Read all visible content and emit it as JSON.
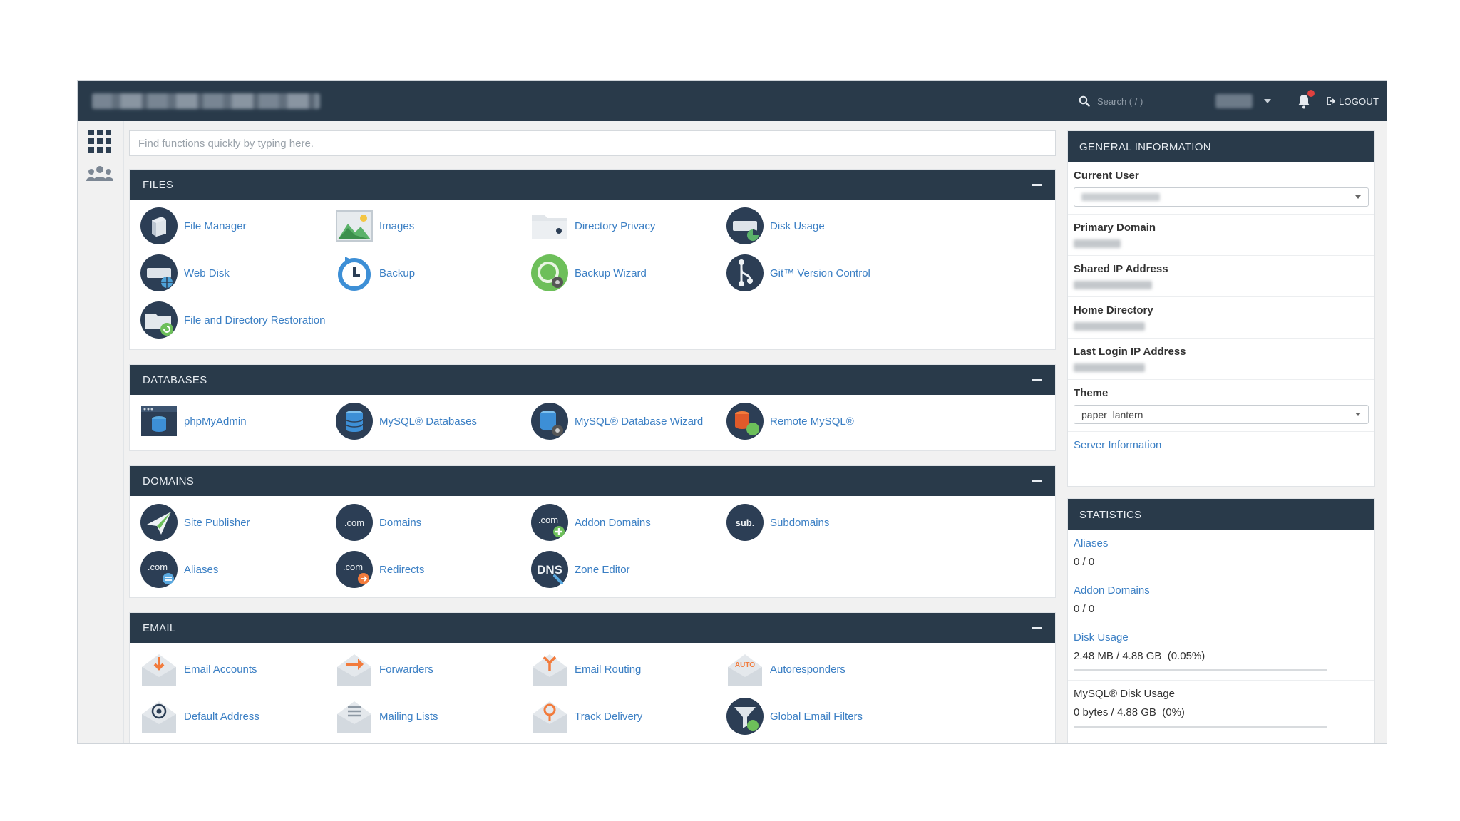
{
  "header": {
    "search_placeholder": "Search ( / )",
    "logout_label": "LOGOUT"
  },
  "quick_search": {
    "placeholder": "Find functions quickly by typing here."
  },
  "sections": [
    {
      "title": "FILES",
      "items": [
        {
          "label": "File Manager",
          "icon": "file-manager-icon"
        },
        {
          "label": "Images",
          "icon": "images-icon"
        },
        {
          "label": "Directory Privacy",
          "icon": "directory-privacy-icon"
        },
        {
          "label": "Disk Usage",
          "icon": "disk-usage-icon"
        },
        {
          "label": "Web Disk",
          "icon": "web-disk-icon"
        },
        {
          "label": "Backup",
          "icon": "backup-icon"
        },
        {
          "label": "Backup Wizard",
          "icon": "backup-wizard-icon"
        },
        {
          "label": "Git™ Version Control",
          "icon": "git-icon"
        },
        {
          "label": "File and Directory Restoration",
          "icon": "restoration-icon"
        }
      ]
    },
    {
      "title": "DATABASES",
      "items": [
        {
          "label": "phpMyAdmin",
          "icon": "phpmyadmin-icon"
        },
        {
          "label": "MySQL® Databases",
          "icon": "mysql-databases-icon"
        },
        {
          "label": "MySQL® Database Wizard",
          "icon": "mysql-wizard-icon"
        },
        {
          "label": "Remote MySQL®",
          "icon": "remote-mysql-icon"
        }
      ]
    },
    {
      "title": "DOMAINS",
      "items": [
        {
          "label": "Site Publisher",
          "icon": "site-publisher-icon"
        },
        {
          "label": "Domains",
          "icon": "domains-icon",
          "badge": ".com"
        },
        {
          "label": "Addon Domains",
          "icon": "addon-domains-icon",
          "badge": ".com"
        },
        {
          "label": "Subdomains",
          "icon": "subdomains-icon",
          "badge": "sub."
        },
        {
          "label": "Aliases",
          "icon": "aliases-icon",
          "badge": ".com"
        },
        {
          "label": "Redirects",
          "icon": "redirects-icon",
          "badge": ".com"
        },
        {
          "label": "Zone Editor",
          "icon": "zone-editor-icon",
          "badge": "DNS"
        }
      ]
    },
    {
      "title": "EMAIL",
      "items": [
        {
          "label": "Email Accounts",
          "icon": "email-accounts-icon"
        },
        {
          "label": "Forwarders",
          "icon": "forwarders-icon"
        },
        {
          "label": "Email Routing",
          "icon": "email-routing-icon"
        },
        {
          "label": "Autoresponders",
          "icon": "autoresponders-icon",
          "badge": "AUTO"
        },
        {
          "label": "Default Address",
          "icon": "default-address-icon"
        },
        {
          "label": "Mailing Lists",
          "icon": "mailing-lists-icon"
        },
        {
          "label": "Track Delivery",
          "icon": "track-delivery-icon"
        },
        {
          "label": "Global Email Filters",
          "icon": "global-filters-icon"
        }
      ]
    }
  ],
  "general_info": {
    "title": "GENERAL INFORMATION",
    "current_user_label": "Current User",
    "primary_domain_label": "Primary Domain",
    "shared_ip_label": "Shared IP Address",
    "home_directory_label": "Home Directory",
    "last_login_label": "Last Login IP Address",
    "theme_label": "Theme",
    "theme_value": "paper_lantern",
    "server_info_link": "Server Information"
  },
  "statistics": {
    "title": "STATISTICS",
    "rows": [
      {
        "label": "Aliases",
        "value": "0 / 0"
      },
      {
        "label": "Addon Domains",
        "value": "0 / 0"
      },
      {
        "label": "Disk Usage",
        "value": "2.48 MB / 4.88 GB  (0.05%)",
        "percent": 0.05
      },
      {
        "label": "MySQL® Disk Usage",
        "value": "0 bytes / 4.88 GB  (0%)",
        "percent": 0
      }
    ]
  },
  "colors": {
    "header_bg": "#293a4a",
    "link": "#3b7fc4",
    "icon_dark": "#2c3e55",
    "icon_accent": "#5aa9e0",
    "email_accent": "#f27b3c",
    "green_badge": "#4caf50"
  }
}
